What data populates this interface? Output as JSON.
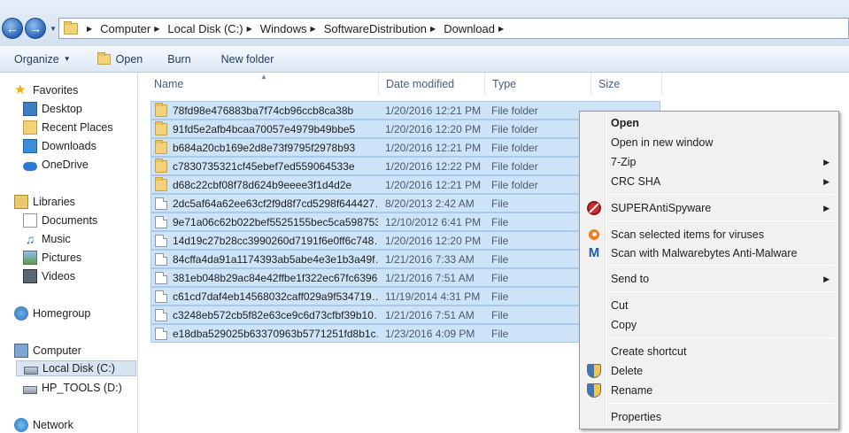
{
  "address": {
    "crumbs": [
      "Computer",
      "Local Disk (C:)",
      "Windows",
      "SoftwareDistribution",
      "Download"
    ]
  },
  "toolbar": {
    "organize": "Organize",
    "open": "Open",
    "burn": "Burn",
    "new_folder": "New folder"
  },
  "nav": {
    "favorites": "Favorites",
    "desktop": "Desktop",
    "recent": "Recent Places",
    "downloads": "Downloads",
    "onedrive": "OneDrive",
    "libraries": "Libraries",
    "documents": "Documents",
    "music": "Music",
    "pictures": "Pictures",
    "videos": "Videos",
    "homegroup": "Homegroup",
    "computer": "Computer",
    "local_disk": "Local Disk (C:)",
    "hp_tools": "HP_TOOLS (D:)",
    "network": "Network"
  },
  "columns": {
    "name": "Name",
    "date": "Date modified",
    "type": "Type",
    "size": "Size"
  },
  "files": [
    {
      "name": "78fd98e476883ba7f74cb96ccb8ca38b",
      "date": "1/20/2016 12:21 PM",
      "type": "File folder",
      "kind": "folder"
    },
    {
      "name": "91fd5e2afb4bcaa70057e4979b49bbe5",
      "date": "1/20/2016 12:20 PM",
      "type": "File folder",
      "kind": "folder"
    },
    {
      "name": "b684a20cb169e2d8e73f9795f2978b93",
      "date": "1/20/2016 12:21 PM",
      "type": "File folder",
      "kind": "folder"
    },
    {
      "name": "c7830735321cf45ebef7ed559064533e",
      "date": "1/20/2016 12:22 PM",
      "type": "File folder",
      "kind": "folder"
    },
    {
      "name": "d68c22cbf08f78d624b9eeee3f1d4d2e",
      "date": "1/20/2016 12:21 PM",
      "type": "File folder",
      "kind": "folder"
    },
    {
      "name": "2dc5af64a62ee63cf2f9d8f7cd5298f644427…",
      "date": "8/20/2013 2:42 AM",
      "type": "File",
      "kind": "file"
    },
    {
      "name": "9e71a06c62b022bef5525155bec5ca598753…",
      "date": "12/10/2012 6:41 PM",
      "type": "File",
      "kind": "file"
    },
    {
      "name": "14d19c27b28cc3990260d7191f6e0ff6c748…",
      "date": "1/20/2016 12:20 PM",
      "type": "File",
      "kind": "file"
    },
    {
      "name": "84cffa4da91a1174393ab5abe4e3e1b3a49f…",
      "date": "1/21/2016 7:33 AM",
      "type": "File",
      "kind": "file"
    },
    {
      "name": "381eb048b29ac84e42ffbe1f322ec67fc6396…",
      "date": "1/21/2016 7:51 AM",
      "type": "File",
      "kind": "file"
    },
    {
      "name": "c61cd7daf4eb14568032caff029a9f534719…",
      "date": "11/19/2014 4:31 PM",
      "type": "File",
      "kind": "file"
    },
    {
      "name": "c3248eb572cb5f82e63ce9c6d73cfbf39b10…",
      "date": "1/21/2016 7:51 AM",
      "type": "File",
      "kind": "file"
    },
    {
      "name": "e18dba529025b63370963b5771251fd8b1c…",
      "date": "1/23/2016 4:09 PM",
      "type": "File",
      "kind": "file"
    }
  ],
  "menu": {
    "open": "Open",
    "open_new_window": "Open in new window",
    "seven_zip": "7-Zip",
    "crc_sha": "CRC SHA",
    "superantispyware": "SUPERAntiSpyware",
    "scan_viruses": "Scan selected items for viruses",
    "scan_malwarebytes": "Scan with Malwarebytes Anti-Malware",
    "send_to": "Send to",
    "cut": "Cut",
    "copy": "Copy",
    "create_shortcut": "Create shortcut",
    "delete": "Delete",
    "rename": "Rename",
    "properties": "Properties"
  },
  "icons": {
    "back": "back-arrow-icon",
    "forward": "forward-arrow-icon",
    "folder": "folder-icon",
    "file": "file-icon"
  },
  "colors": {
    "selection": "#cde3f8",
    "selection_border": "#a9c9ec",
    "toolbar_text": "#1e3a5f"
  }
}
